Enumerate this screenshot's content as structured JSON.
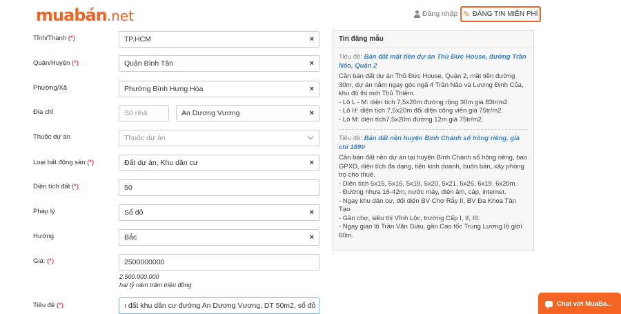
{
  "header": {
    "logo_main": "muabán",
    "logo_suffix": ".net",
    "login_label": "Đăng nhập",
    "post_button_label": "ĐĂNG TIN MIỄN PHÍ"
  },
  "form": {
    "province": {
      "label": "Tỉnh/Thành",
      "required": "(*)",
      "value": "TP.HCM"
    },
    "district": {
      "label": "Quận/Huyện",
      "required": "(*)",
      "value": "Quận Bình Tân"
    },
    "ward": {
      "label": "Phường/Xã",
      "value": "Phường Bình Hưng Hòa"
    },
    "address": {
      "label": "Địa chỉ",
      "house_placeholder": "Số nhà",
      "street_value": "An Dương Vương"
    },
    "project": {
      "label": "Thuộc dự án",
      "placeholder": "Thuộc dự án"
    },
    "property_type": {
      "label": "Loại bất động sản",
      "required": "(*)",
      "value": "Đất dự án, Khu dân cư"
    },
    "area": {
      "label": "Diện tích đất",
      "required": "(*)",
      "value": "50"
    },
    "legal": {
      "label": "Pháp lý",
      "value": "Sổ đỏ"
    },
    "direction": {
      "label": "Hướng",
      "value": "Bắc"
    },
    "price": {
      "label": "Giá:",
      "required": "(*)",
      "value": "2500000000",
      "formatted": "2.500.000.000",
      "in_words": "hai tỷ năm trăm triệu đồng"
    },
    "title": {
      "label": "Tiêu đề",
      "required": "(*)",
      "value": "ı đất khu dân cư đường An Dương Vương, DT 50m2, sổ đỏ"
    }
  },
  "sample_panel": {
    "heading": "Tin đăng mẫu",
    "samples": [
      {
        "title_label": "Tiêu đề:",
        "title": "Bán đất mặt tiền dự án Thủ Đức House, đường Trần Não, Quận 2",
        "lines": [
          "Cần bán đất dự án Thủ Đức House, Quận 2, mặt tiền đường 30m, dự án nằm ngay góc ngã 4 Trần Não và Lương Định Của, khu đô thị mới Thủ Thiêm.",
          "- Lô L - M: diện tích 7,5x20m đường rộng 30m giá 83tr/m2.",
          "- Lô H: diện tích 7,5x20m đối diện công viên giá 75tr/m2.",
          "- Lô M: diện tích7,5x20m đường 12m giá 75tr/m2."
        ]
      },
      {
        "title_label": "Tiêu đề:",
        "title": "Bán đất nền huyện Bình Chánh sổ hồng riêng, giá chỉ 189tr",
        "lines": [
          "Cần bán đất nền dự án tại huyện Bình Chánh sổ hồng riêng, bao GPXD, diện tích đa dạng, tiện kinh doanh, buôn bán, xây phòng trọ cho thuê.",
          "- Diện tích 5x15, 5x16, 5x19, 5x20, 5x21, 5x26, 6x19, 6x20m.",
          "- Đường nhựa 16-42m, nước máy, điện âm, cáp, internet.",
          "- Ngay khu dân cư, đối diện BV Chợ Rẫy II, BV Đa Khoa Tân Tạo",
          "- Gần chợ, siêu thị Vĩnh Lộc, trường Cấp I, II, III.",
          "- Ngay giao lộ Trần Văn Giàu, gần Cao tốc Trung Lương lộ giới 60m."
        ]
      }
    ]
  },
  "chat": {
    "label": "Chat với MuaBa..."
  },
  "colors": {
    "brand": "#f26522",
    "link": "#3d7ec5",
    "required": "#d0021b"
  }
}
